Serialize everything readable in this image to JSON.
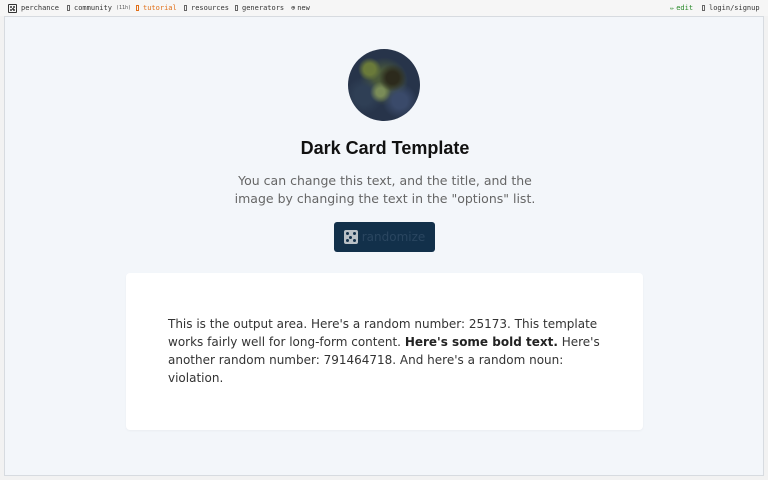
{
  "nav": {
    "perchance": "perchance",
    "community": "community",
    "community_count": "(11h)",
    "tutorial": "tutorial",
    "resources": "resources",
    "generators": "generators",
    "new": "new",
    "edit": "edit",
    "login": "login/signup"
  },
  "card": {
    "title": "Dark Card Template",
    "description": "You can change this text, and the title, and the image by changing the text in the \"options\" list.",
    "button_label": "randomize"
  },
  "output": {
    "part1": "This is the output area. Here's a random number: 25173. This template works fairly well for long-form content.",
    "bold": "Here's some bold text.",
    "part2": "Here's another random number: 791464718. And here's a random noun: violation."
  },
  "colors": {
    "accent_tutorial": "#e0701a",
    "accent_edit": "#2a8a2a",
    "button_bg": "#12304a"
  },
  "icons": {
    "perchance": "dice-icon",
    "community": "box-icon",
    "tutorial": "box-icon",
    "resources": "box-icon",
    "generators": "box-icon",
    "new": "plus-circle-icon",
    "edit": "pencil-icon",
    "login": "box-icon",
    "button": "dice-icon"
  }
}
